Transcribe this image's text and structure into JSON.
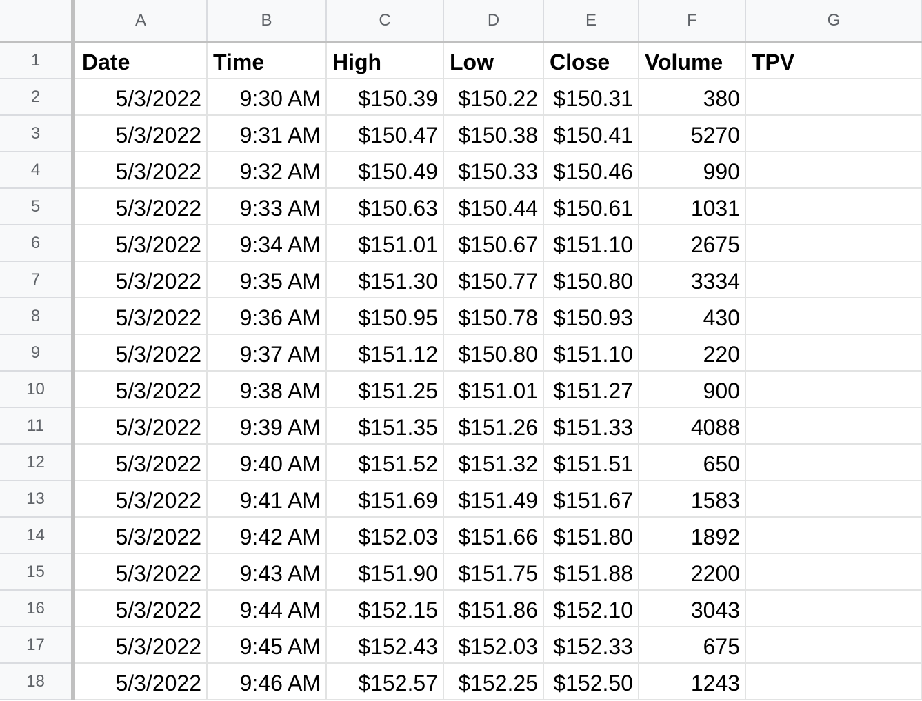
{
  "columns": [
    "A",
    "B",
    "C",
    "D",
    "E",
    "F",
    "G"
  ],
  "header": {
    "row_number": "1",
    "cells": [
      "Date",
      "Time",
      "High",
      "Low",
      "Close",
      "Volume",
      "TPV"
    ]
  },
  "rows": [
    {
      "row_number": "2",
      "cells": [
        "5/3/2022",
        "9:30 AM",
        "$150.39",
        "$150.22",
        "$150.31",
        "380",
        ""
      ]
    },
    {
      "row_number": "3",
      "cells": [
        "5/3/2022",
        "9:31 AM",
        "$150.47",
        "$150.38",
        "$150.41",
        "5270",
        ""
      ]
    },
    {
      "row_number": "4",
      "cells": [
        "5/3/2022",
        "9:32 AM",
        "$150.49",
        "$150.33",
        "$150.46",
        "990",
        ""
      ]
    },
    {
      "row_number": "5",
      "cells": [
        "5/3/2022",
        "9:33 AM",
        "$150.63",
        "$150.44",
        "$150.61",
        "1031",
        ""
      ]
    },
    {
      "row_number": "6",
      "cells": [
        "5/3/2022",
        "9:34 AM",
        "$151.01",
        "$150.67",
        "$151.10",
        "2675",
        ""
      ]
    },
    {
      "row_number": "7",
      "cells": [
        "5/3/2022",
        "9:35 AM",
        "$151.30",
        "$150.77",
        "$150.80",
        "3334",
        ""
      ]
    },
    {
      "row_number": "8",
      "cells": [
        "5/3/2022",
        "9:36 AM",
        "$150.95",
        "$150.78",
        "$150.93",
        "430",
        ""
      ]
    },
    {
      "row_number": "9",
      "cells": [
        "5/3/2022",
        "9:37 AM",
        "$151.12",
        "$150.80",
        "$151.10",
        "220",
        ""
      ]
    },
    {
      "row_number": "10",
      "cells": [
        "5/3/2022",
        "9:38 AM",
        "$151.25",
        "$151.01",
        "$151.27",
        "900",
        ""
      ]
    },
    {
      "row_number": "11",
      "cells": [
        "5/3/2022",
        "9:39 AM",
        "$151.35",
        "$151.26",
        "$151.33",
        "4088",
        ""
      ]
    },
    {
      "row_number": "12",
      "cells": [
        "5/3/2022",
        "9:40 AM",
        "$151.52",
        "$151.32",
        "$151.51",
        "650",
        ""
      ]
    },
    {
      "row_number": "13",
      "cells": [
        "5/3/2022",
        "9:41 AM",
        "$151.69",
        "$151.49",
        "$151.67",
        "1583",
        ""
      ]
    },
    {
      "row_number": "14",
      "cells": [
        "5/3/2022",
        "9:42 AM",
        "$152.03",
        "$151.66",
        "$151.80",
        "1892",
        ""
      ]
    },
    {
      "row_number": "15",
      "cells": [
        "5/3/2022",
        "9:43 AM",
        "$151.90",
        "$151.75",
        "$151.88",
        "2200",
        ""
      ]
    },
    {
      "row_number": "16",
      "cells": [
        "5/3/2022",
        "9:44 AM",
        "$152.15",
        "$151.86",
        "$152.10",
        "3043",
        ""
      ]
    },
    {
      "row_number": "17",
      "cells": [
        "5/3/2022",
        "9:45 AM",
        "$152.43",
        "$152.03",
        "$152.33",
        "675",
        ""
      ]
    },
    {
      "row_number": "18",
      "cells": [
        "5/3/2022",
        "9:46 AM",
        "$152.57",
        "$152.25",
        "$152.50",
        "1243",
        ""
      ]
    }
  ]
}
